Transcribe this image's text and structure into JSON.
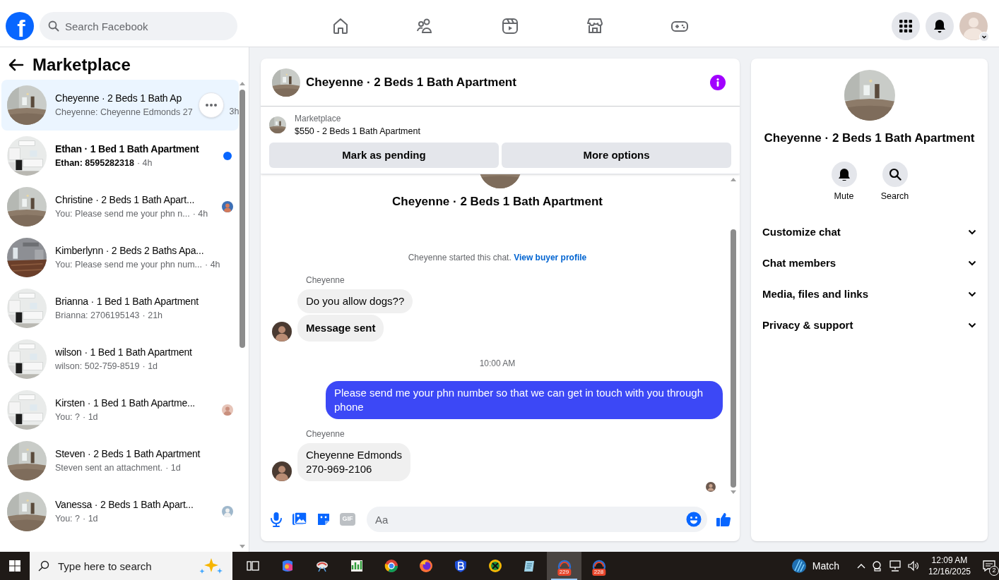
{
  "top_bar": {
    "logo_letter": "f",
    "search": {
      "placeholder": "Search Facebook"
    },
    "nav": [
      {
        "selected": false
      },
      {
        "selected": false
      },
      {
        "selected": false
      },
      {
        "selected": false
      },
      {
        "selected": false
      }
    ]
  },
  "sidebar": {
    "title": "Marketplace",
    "conversations": [
      {
        "title": "Cheyenne · 2 Beds 1 Bath Ap",
        "preview": "Cheyenne: Cheyenne Edmonds 27",
        "time": "3h",
        "selected": true,
        "hovered": true,
        "unread": false,
        "seen_avatar": false
      },
      {
        "title": "Ethan · 1 Bed 1 Bath Apartment",
        "preview": "Ethan: 8595282318",
        "time": "· 4h",
        "selected": false,
        "hovered": false,
        "unread": true,
        "seen_avatar": false
      },
      {
        "title": "Christine · 2 Beds 1 Bath Apart...",
        "preview": "You: Please send me your phn n...",
        "time": "· 4h",
        "selected": false,
        "hovered": false,
        "unread": false,
        "seen_avatar": true
      },
      {
        "title": "Kimberlynn · 2 Beds 2 Baths Apa...",
        "preview": "You: Please send me your phn num...",
        "time": "· 4h",
        "selected": false,
        "hovered": false,
        "unread": false,
        "seen_avatar": false
      },
      {
        "title": "Brianna · 1 Bed 1 Bath Apartment",
        "preview": "Brianna: 2706195143",
        "time": "· 21h",
        "selected": false,
        "hovered": false,
        "unread": false,
        "seen_avatar": false
      },
      {
        "title": "wilson · 1 Bed 1 Bath Apartment",
        "preview": "wilson: 502-759-8519",
        "time": "· 1d",
        "selected": false,
        "hovered": false,
        "unread": false,
        "seen_avatar": false
      },
      {
        "title": "Kirsten · 1 Bed 1 Bath Apartme...",
        "preview": "You: ?",
        "time": "· 1d",
        "selected": false,
        "hovered": false,
        "unread": false,
        "seen_avatar": true
      },
      {
        "title": "Steven · 2 Beds 1 Bath Apartment",
        "preview": "Steven sent an attachment.",
        "time": "· 1d",
        "selected": false,
        "hovered": false,
        "unread": false,
        "seen_avatar": false
      },
      {
        "title": "Vanessa · 2 Beds 1 Bath Apart...",
        "preview": "You: ?",
        "time": "· 1d",
        "selected": false,
        "hovered": false,
        "unread": false,
        "seen_avatar": true
      }
    ]
  },
  "chat": {
    "title": "Cheyenne · 2 Beds 1 Bath Apartment",
    "listing": {
      "label": "Marketplace",
      "title": "$550 - 2 Beds 1 Bath Apartment"
    },
    "actions": [
      "Mark as pending",
      "More options"
    ],
    "intro": {
      "title": "Cheyenne · 2 Beds 1 Bath Apartment",
      "text": "Cheyenne started this chat.",
      "link": "View buyer profile"
    },
    "messages": [
      {
        "kind": "sender",
        "text": "Cheyenne"
      },
      {
        "kind": "incoming",
        "text": "Do you allow dogs??",
        "bold": false,
        "avatar": false
      },
      {
        "kind": "incoming",
        "text": "Message sent",
        "bold": true,
        "avatar": true
      },
      {
        "kind": "time",
        "text": "10:00 AM"
      },
      {
        "kind": "outgoing",
        "text": "Please send me your phn number so that we can get in touch with you through phone"
      },
      {
        "kind": "sender",
        "text": "Cheyenne"
      },
      {
        "kind": "incoming",
        "text": "Cheyenne Edmonds\n270-969-2106",
        "bold": false,
        "avatar": true
      }
    ],
    "composer": {
      "gif": "GIF",
      "placeholder": "Aa"
    }
  },
  "details": {
    "title": "Cheyenne · 2 Beds 1 Bath Apartment",
    "actions": [
      {
        "label": "Mute"
      },
      {
        "label": "Search"
      }
    ],
    "sections": [
      {
        "label": "Customize chat",
        "expanded": false
      },
      {
        "label": "Chat members",
        "expanded": false
      },
      {
        "label": "Media, files and links",
        "expanded": false
      },
      {
        "label": "Privacy & support",
        "expanded": false
      }
    ]
  },
  "taskbar": {
    "search_placeholder": "Type here to search",
    "apps": [
      {
        "active": false
      },
      {
        "active": false
      },
      {
        "active": false
      },
      {
        "active": false
      },
      {
        "active": false
      },
      {
        "active": false
      },
      {
        "active": false
      },
      {
        "active": false
      },
      {
        "active": false
      },
      {
        "active": true,
        "badge": "229"
      },
      {
        "active": false,
        "badge": "228"
      }
    ],
    "weather": "Match",
    "time": "12:09 AM",
    "date": "12/16/2025",
    "notifications": "2"
  }
}
